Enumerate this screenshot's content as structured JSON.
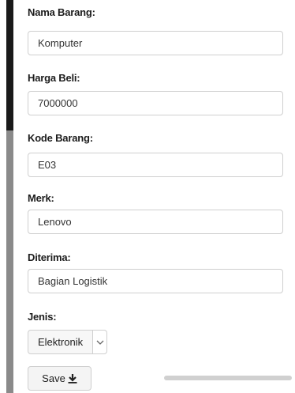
{
  "form": {
    "nama_barang": {
      "label": "Nama Barang:",
      "value": "Komputer"
    },
    "harga_beli": {
      "label": "Harga Beli:",
      "value": "7000000"
    },
    "kode_barang": {
      "label": "Kode Barang:",
      "value": "E03"
    },
    "merk": {
      "label": "Merk:",
      "value": "Lenovo"
    },
    "diterima": {
      "label": "Diterima:",
      "value": "Bagian Logistik"
    },
    "jenis": {
      "label": "Jenis:",
      "selected": "Elektronik"
    },
    "save_label": "Save"
  },
  "icons": {
    "select_arrow": "chevron-down-icon",
    "save": "download-icon"
  }
}
